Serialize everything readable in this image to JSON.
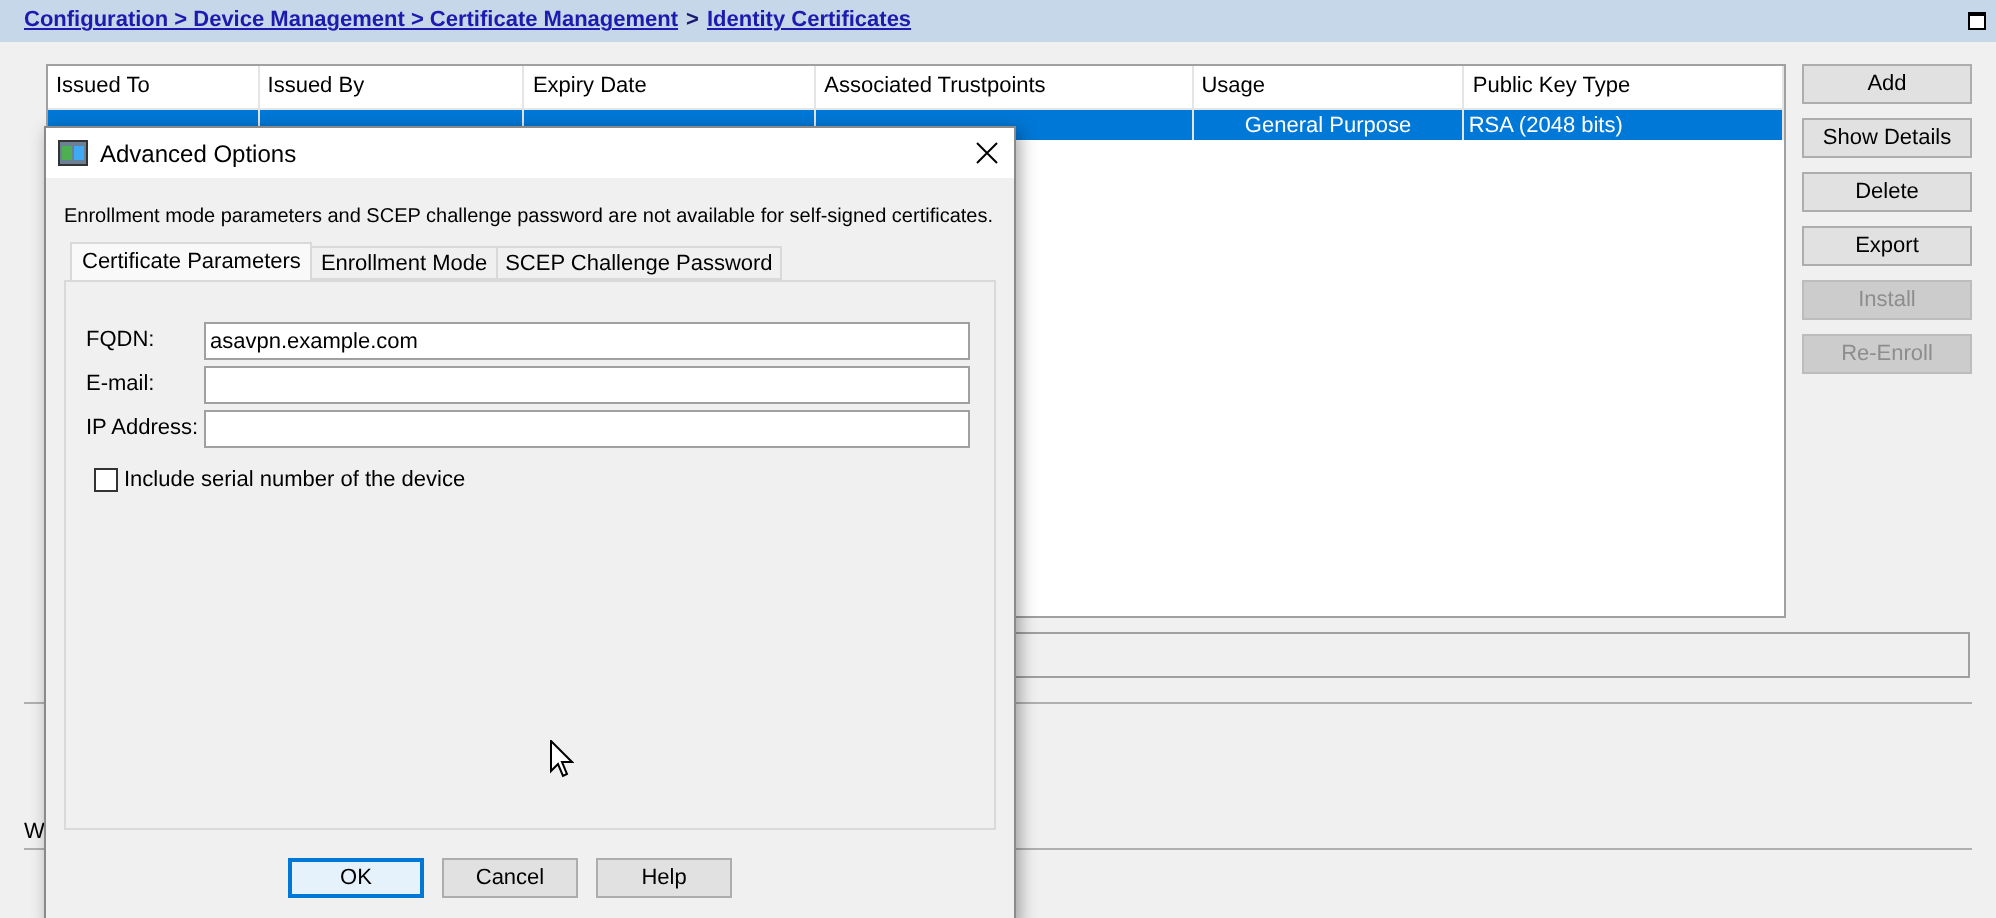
{
  "breadcrumb": {
    "links": [
      "Configuration > Device Management > Certificate Management",
      "Identity Certificates"
    ],
    "separator": ">"
  },
  "table": {
    "columns": [
      "Issued To",
      "Issued By",
      "Expiry Date",
      "Associated Trustpoints",
      "Usage",
      "Public Key Type"
    ],
    "rows": [
      {
        "selected": true,
        "cells": [
          "",
          "",
          "",
          "",
          "General Purpose",
          "RSA (2048 bits)"
        ]
      }
    ]
  },
  "buttons": [
    {
      "label": "Add",
      "disabled": false
    },
    {
      "label": "Show Details",
      "disabled": false
    },
    {
      "label": "Delete",
      "disabled": false
    },
    {
      "label": "Export",
      "disabled": false
    },
    {
      "label": "Install",
      "disabled": true
    },
    {
      "label": "Re-Enroll",
      "disabled": true
    }
  ],
  "footer_text": "W",
  "dialog": {
    "title": "Advanced Options",
    "message": "Enrollment mode parameters and SCEP challenge password are not available for self-signed certificates.",
    "tabs": [
      {
        "label": "Certificate Parameters",
        "selected": true
      },
      {
        "label": "Enrollment Mode",
        "selected": false
      },
      {
        "label": "SCEP Challenge Password",
        "selected": false
      }
    ],
    "fields": [
      {
        "label": "FQDN:",
        "value": "asavpn.example.com"
      },
      {
        "label": "E-mail:"
      },
      {
        "label": "IP Address:"
      }
    ],
    "checkbox": {
      "label": "Include serial number of the device",
      "checked": false
    },
    "buttons": [
      {
        "label": "OK",
        "default": true
      },
      {
        "label": "Cancel",
        "default": false
      },
      {
        "label": "Help",
        "default": false
      }
    ]
  }
}
